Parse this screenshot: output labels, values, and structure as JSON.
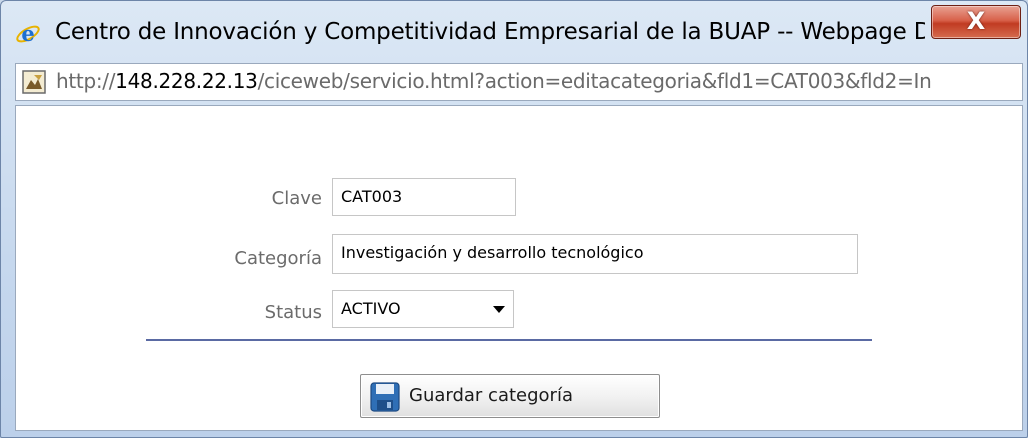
{
  "window": {
    "title": "Centro de Innovación y Competitividad Empresarial de la BUAP -- Webpage Di...",
    "close_symbol": "X"
  },
  "address": {
    "url_prefix": "http://",
    "url_host": "148.228.22.13",
    "url_rest": "/ciceweb/servicio.html?action=editacategoria&fld1=CAT003&fld2=In"
  },
  "form": {
    "clave": {
      "label": "Clave",
      "value": "CAT003"
    },
    "categoria": {
      "label": "Categoría",
      "value": "Investigación y desarrollo tecnológico"
    },
    "status": {
      "label": "Status",
      "value": "ACTIVO"
    },
    "save_label": "Guardar categoría"
  },
  "colors": {
    "divider": "#5a6aa3",
    "close_button": "#c13b22"
  },
  "icons": {
    "browser": "internet-explorer-icon",
    "page": "page-icon",
    "save": "floppy-disk-icon",
    "dropdown": "triangle-down-icon"
  }
}
